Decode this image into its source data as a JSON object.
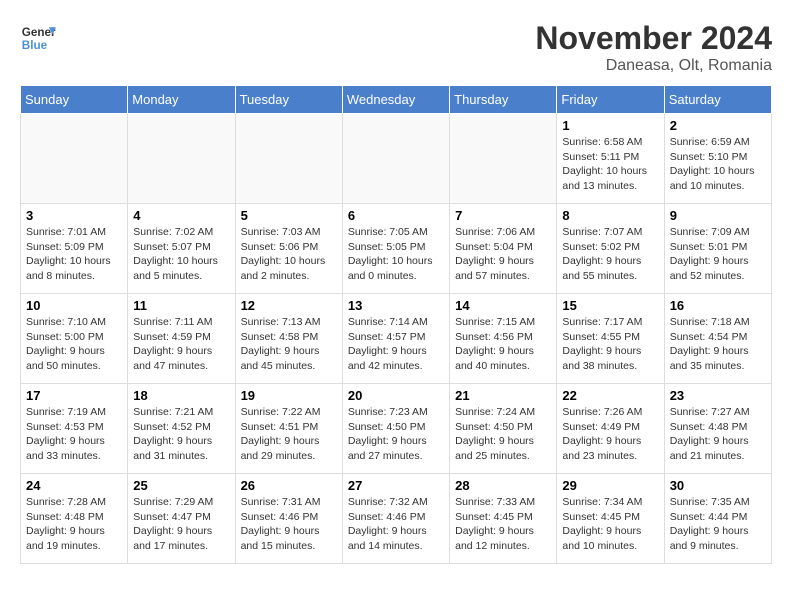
{
  "header": {
    "logo_general": "General",
    "logo_blue": "Blue",
    "month_title": "November 2024",
    "location": "Daneasa, Olt, Romania"
  },
  "days_of_week": [
    "Sunday",
    "Monday",
    "Tuesday",
    "Wednesday",
    "Thursday",
    "Friday",
    "Saturday"
  ],
  "weeks": [
    [
      {
        "day": "",
        "info": ""
      },
      {
        "day": "",
        "info": ""
      },
      {
        "day": "",
        "info": ""
      },
      {
        "day": "",
        "info": ""
      },
      {
        "day": "",
        "info": ""
      },
      {
        "day": "1",
        "info": "Sunrise: 6:58 AM\nSunset: 5:11 PM\nDaylight: 10 hours and 13 minutes."
      },
      {
        "day": "2",
        "info": "Sunrise: 6:59 AM\nSunset: 5:10 PM\nDaylight: 10 hours and 10 minutes."
      }
    ],
    [
      {
        "day": "3",
        "info": "Sunrise: 7:01 AM\nSunset: 5:09 PM\nDaylight: 10 hours and 8 minutes."
      },
      {
        "day": "4",
        "info": "Sunrise: 7:02 AM\nSunset: 5:07 PM\nDaylight: 10 hours and 5 minutes."
      },
      {
        "day": "5",
        "info": "Sunrise: 7:03 AM\nSunset: 5:06 PM\nDaylight: 10 hours and 2 minutes."
      },
      {
        "day": "6",
        "info": "Sunrise: 7:05 AM\nSunset: 5:05 PM\nDaylight: 10 hours and 0 minutes."
      },
      {
        "day": "7",
        "info": "Sunrise: 7:06 AM\nSunset: 5:04 PM\nDaylight: 9 hours and 57 minutes."
      },
      {
        "day": "8",
        "info": "Sunrise: 7:07 AM\nSunset: 5:02 PM\nDaylight: 9 hours and 55 minutes."
      },
      {
        "day": "9",
        "info": "Sunrise: 7:09 AM\nSunset: 5:01 PM\nDaylight: 9 hours and 52 minutes."
      }
    ],
    [
      {
        "day": "10",
        "info": "Sunrise: 7:10 AM\nSunset: 5:00 PM\nDaylight: 9 hours and 50 minutes."
      },
      {
        "day": "11",
        "info": "Sunrise: 7:11 AM\nSunset: 4:59 PM\nDaylight: 9 hours and 47 minutes."
      },
      {
        "day": "12",
        "info": "Sunrise: 7:13 AM\nSunset: 4:58 PM\nDaylight: 9 hours and 45 minutes."
      },
      {
        "day": "13",
        "info": "Sunrise: 7:14 AM\nSunset: 4:57 PM\nDaylight: 9 hours and 42 minutes."
      },
      {
        "day": "14",
        "info": "Sunrise: 7:15 AM\nSunset: 4:56 PM\nDaylight: 9 hours and 40 minutes."
      },
      {
        "day": "15",
        "info": "Sunrise: 7:17 AM\nSunset: 4:55 PM\nDaylight: 9 hours and 38 minutes."
      },
      {
        "day": "16",
        "info": "Sunrise: 7:18 AM\nSunset: 4:54 PM\nDaylight: 9 hours and 35 minutes."
      }
    ],
    [
      {
        "day": "17",
        "info": "Sunrise: 7:19 AM\nSunset: 4:53 PM\nDaylight: 9 hours and 33 minutes."
      },
      {
        "day": "18",
        "info": "Sunrise: 7:21 AM\nSunset: 4:52 PM\nDaylight: 9 hours and 31 minutes."
      },
      {
        "day": "19",
        "info": "Sunrise: 7:22 AM\nSunset: 4:51 PM\nDaylight: 9 hours and 29 minutes."
      },
      {
        "day": "20",
        "info": "Sunrise: 7:23 AM\nSunset: 4:50 PM\nDaylight: 9 hours and 27 minutes."
      },
      {
        "day": "21",
        "info": "Sunrise: 7:24 AM\nSunset: 4:50 PM\nDaylight: 9 hours and 25 minutes."
      },
      {
        "day": "22",
        "info": "Sunrise: 7:26 AM\nSunset: 4:49 PM\nDaylight: 9 hours and 23 minutes."
      },
      {
        "day": "23",
        "info": "Sunrise: 7:27 AM\nSunset: 4:48 PM\nDaylight: 9 hours and 21 minutes."
      }
    ],
    [
      {
        "day": "24",
        "info": "Sunrise: 7:28 AM\nSunset: 4:48 PM\nDaylight: 9 hours and 19 minutes."
      },
      {
        "day": "25",
        "info": "Sunrise: 7:29 AM\nSunset: 4:47 PM\nDaylight: 9 hours and 17 minutes."
      },
      {
        "day": "26",
        "info": "Sunrise: 7:31 AM\nSunset: 4:46 PM\nDaylight: 9 hours and 15 minutes."
      },
      {
        "day": "27",
        "info": "Sunrise: 7:32 AM\nSunset: 4:46 PM\nDaylight: 9 hours and 14 minutes."
      },
      {
        "day": "28",
        "info": "Sunrise: 7:33 AM\nSunset: 4:45 PM\nDaylight: 9 hours and 12 minutes."
      },
      {
        "day": "29",
        "info": "Sunrise: 7:34 AM\nSunset: 4:45 PM\nDaylight: 9 hours and 10 minutes."
      },
      {
        "day": "30",
        "info": "Sunrise: 7:35 AM\nSunset: 4:44 PM\nDaylight: 9 hours and 9 minutes."
      }
    ]
  ]
}
